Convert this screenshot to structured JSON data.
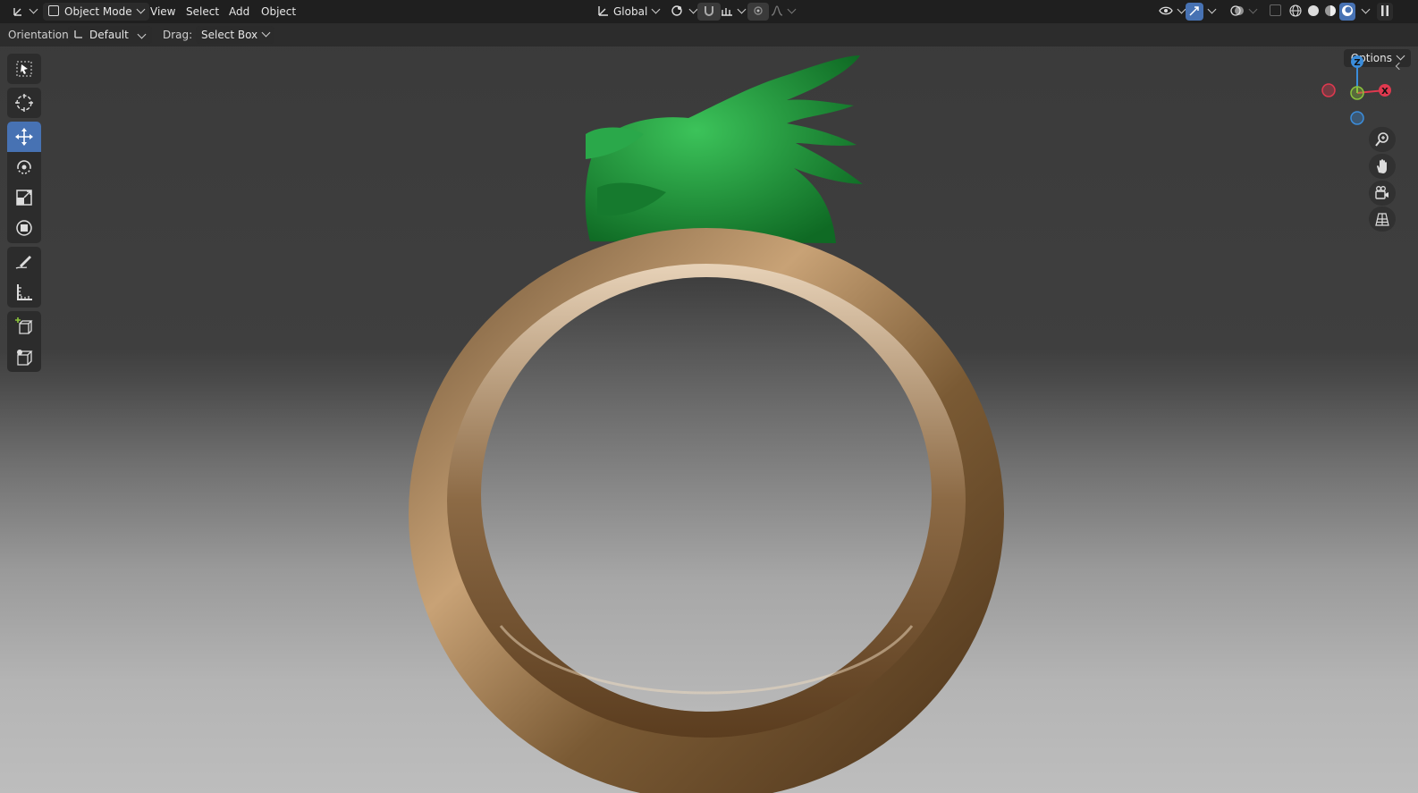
{
  "header": {
    "mode_label": "Object Mode",
    "menu": [
      "View",
      "Select",
      "Add",
      "Object"
    ],
    "transform_orientation": "Global"
  },
  "tool_settings": {
    "orientation_label": "Orientation:",
    "orientation_value": "Default",
    "drag_label": "Drag:",
    "drag_value": "Select Box",
    "options_label": "Options"
  },
  "gizmo": {
    "z_label": "Z",
    "x_label": "X",
    "x_color": "#e0394f",
    "y_color": "#8bc43c",
    "z_color": "#3b8ddb"
  },
  "toolbar_icons": [
    "select-box-icon",
    "cursor-icon",
    "move-icon",
    "rotate-icon",
    "scale-icon",
    "transform-icon",
    "annotate-icon",
    "measure-icon",
    "add-cube-icon",
    "extrude-icon"
  ],
  "colors": {
    "accent": "#4772b3",
    "ring_gold": "#9a7448",
    "dragon_green": "#1f8a34"
  }
}
